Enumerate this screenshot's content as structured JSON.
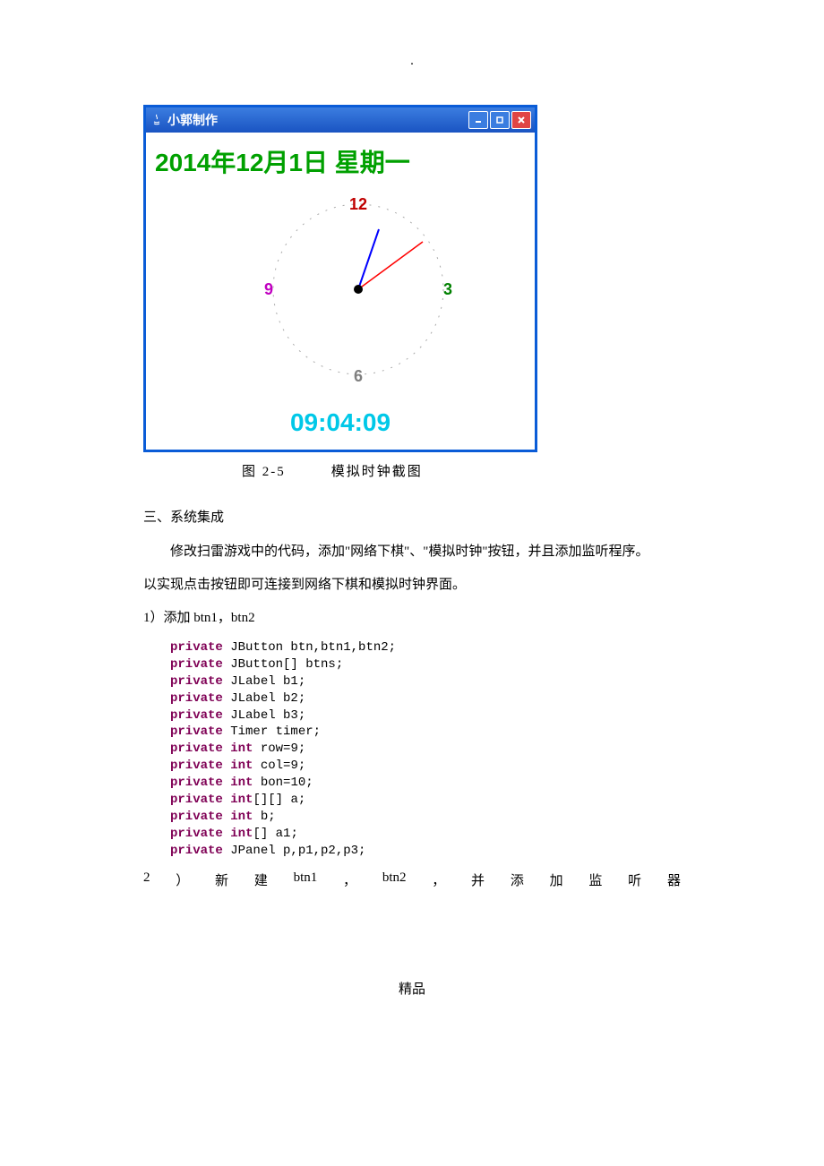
{
  "header_dot": ".",
  "clock_window": {
    "title": "小郭制作",
    "date_line": "2014年12月1日 星期一",
    "face": {
      "numbers": {
        "n12": "12",
        "n3": "3",
        "n6": "6",
        "n9": "9"
      }
    },
    "digital_time": "09:04:09"
  },
  "figure_caption": "图 2-5　　　模拟时钟截图",
  "section3_heading": "三、系统集成",
  "section3_para1": "修改扫雷游戏中的代码，添加\"网络下棋\"、\"模拟时钟\"按钮，并且添加监听程序。",
  "section3_para2": "以实现点击按钮即可连接到网络下棋和模拟时钟界面。",
  "step1_label": "1）添加 btn1，btn2",
  "code": {
    "l1a": "private",
    "l1b": " JButton btn,btn1,btn2;",
    "l2a": "private",
    "l2b": " JButton[] btns;",
    "l3a": "private",
    "l3b": " JLabel b1;",
    "l4a": "private",
    "l4b": " JLabel b2;",
    "l5a": "private",
    "l5b": " JLabel b3;",
    "l6a": "private",
    "l6b": " Timer timer;",
    "l7a": "private",
    "l7b": " ",
    "l7c": "int",
    "l7d": " row=9;",
    "l8a": "private",
    "l8b": " ",
    "l8c": "int",
    "l8d": " col=9;",
    "l9a": "private",
    "l9b": " ",
    "l9c": "int",
    "l9d": " bon=10;",
    "l10a": "private",
    "l10b": " ",
    "l10c": "int",
    "l10d": "[][] a;",
    "l11a": "private",
    "l11b": " ",
    "l11c": "int",
    "l11d": " b;",
    "l12a": "private",
    "l12b": " ",
    "l12c": "int",
    "l12d": "[] a1;",
    "l13a": "private",
    "l13b": " JPanel p,p1,p2,p3;"
  },
  "step2_chars": [
    "2",
    "）",
    "新",
    "建",
    "btn1",
    "，",
    "btn2",
    "，",
    "并",
    "添",
    "加",
    "监",
    "听",
    "器"
  ],
  "footer": "精品"
}
